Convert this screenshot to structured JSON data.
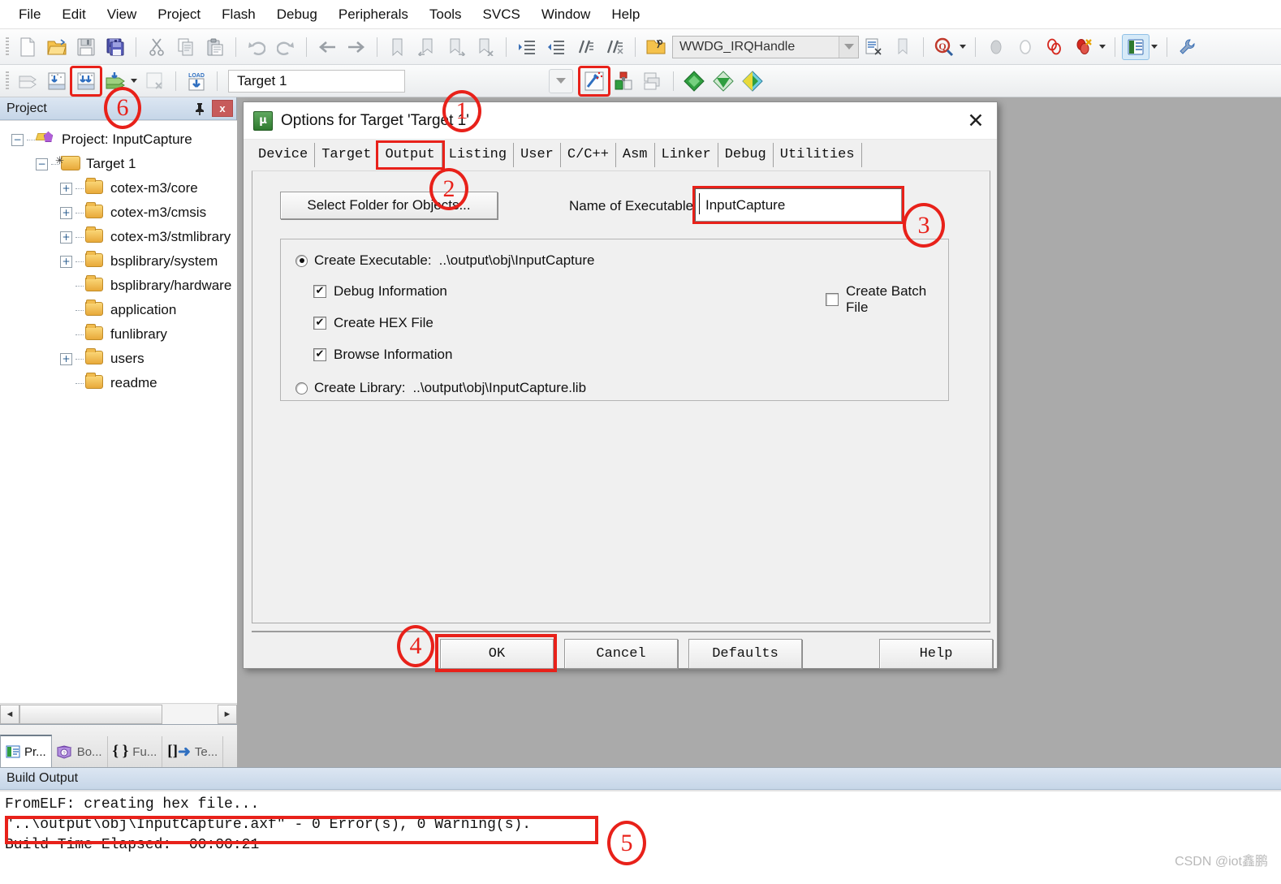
{
  "menubar": {
    "items": [
      {
        "label": "File"
      },
      {
        "label": "Edit"
      },
      {
        "label": "View"
      },
      {
        "label": "Project"
      },
      {
        "label": "Flash"
      },
      {
        "label": "Debug"
      },
      {
        "label": "Peripherals"
      },
      {
        "label": "Tools"
      },
      {
        "label": "SVCS"
      },
      {
        "label": "Window"
      },
      {
        "label": "Help"
      }
    ]
  },
  "toolbar1": {
    "icons": [
      "new-file-icon",
      "open-file-icon",
      "save-icon",
      "save-all-icon",
      "cut-icon",
      "copy-icon",
      "paste-icon",
      "undo-icon",
      "redo-icon",
      "navigate-back-icon",
      "navigate-forward-icon",
      "bookmark-toggle-icon",
      "bookmark-prev-icon",
      "bookmark-next-icon",
      "bookmark-clear-icon",
      "indent-icon",
      "outdent-icon",
      "comment-icon",
      "uncomment-icon",
      "open-file-browse-icon"
    ],
    "function_combo": {
      "value": "WWDG_IRQHandle",
      "dropdown_icon": "chevron-down-icon"
    },
    "after_combo_icons": [
      "file-properties-icon",
      "bookmark-gray-icon",
      "find-in-files-icon",
      "find-dropdown-arrow",
      "breakpoint-gray-icon",
      "breakpoint-hollow-icon",
      "breakpoint-red-icon",
      "breakpoints-kill-icon",
      "breakpoints-dropdown-arrow",
      "window-layout-icon",
      "layout-dropdown-arrow",
      "configure-tools-icon"
    ]
  },
  "toolbar2": {
    "icons": [
      "translate-icon",
      "build-icon",
      "rebuild-all-icon",
      "batch-build-icon",
      "batch-build-dropdown",
      "stop-build-icon",
      "load-download-icon"
    ],
    "target_combo": {
      "value": "Target 1",
      "dropdown_icon": "chevron-down-icon"
    },
    "right_icons": [
      "options-for-target-icon",
      "manage-runtime-env-icon",
      "multi-project-icon",
      "svcs-green-icon",
      "pack-installer-icon",
      "manage-project-items-icon"
    ]
  },
  "project_panel": {
    "title": "Project",
    "pin_icon": "pin-icon",
    "close_icon": "close-icon",
    "tree": [
      {
        "label": "Project: InputCapture",
        "depth": 0,
        "expander": "minus",
        "icon": "project-icon"
      },
      {
        "label": "Target 1",
        "depth": 1,
        "expander": "minus",
        "icon": "target-icon"
      },
      {
        "label": "cotex-m3/core",
        "depth": 2,
        "expander": "plus",
        "icon": "folder-icon"
      },
      {
        "label": "cotex-m3/cmsis",
        "depth": 2,
        "expander": "plus",
        "icon": "folder-icon"
      },
      {
        "label": "cotex-m3/stmlibrary",
        "depth": 2,
        "expander": "plus",
        "icon": "folder-icon"
      },
      {
        "label": "bsplibrary/system",
        "depth": 2,
        "expander": "plus",
        "icon": "folder-icon"
      },
      {
        "label": "bsplibrary/hardware",
        "depth": 2,
        "expander": "none",
        "icon": "folder-icon"
      },
      {
        "label": "application",
        "depth": 2,
        "expander": "none",
        "icon": "folder-icon"
      },
      {
        "label": "funlibrary",
        "depth": 2,
        "expander": "none",
        "icon": "folder-icon"
      },
      {
        "label": "users",
        "depth": 2,
        "expander": "plus",
        "icon": "folder-icon"
      },
      {
        "label": "readme",
        "depth": 2,
        "expander": "none",
        "icon": "folder-icon"
      }
    ],
    "hscroll": {
      "left_arrow": "◄",
      "right_arrow": "►"
    },
    "tabs": [
      {
        "label": "Pr...",
        "icon": "project-window-icon",
        "active": true
      },
      {
        "label": "Bo...",
        "icon": "books-icon",
        "active": false
      },
      {
        "label": "Fu...",
        "icon": "functions-icon",
        "active": false
      },
      {
        "label": "Te...",
        "icon": "templates-icon",
        "active": false
      }
    ]
  },
  "dialog": {
    "icon": "keil-uvision-icon",
    "title": "Options for Target 'Target 1'",
    "close_icon": "close-icon",
    "tabs": [
      {
        "label": "Device",
        "selected": false
      },
      {
        "label": "Target",
        "selected": false
      },
      {
        "label": "Output",
        "selected": true
      },
      {
        "label": "Listing",
        "selected": false
      },
      {
        "label": "User",
        "selected": false
      },
      {
        "label": "C/C++",
        "selected": false
      },
      {
        "label": "Asm",
        "selected": false
      },
      {
        "label": "Linker",
        "selected": false
      },
      {
        "label": "Debug",
        "selected": false
      },
      {
        "label": "Utilities",
        "selected": false
      }
    ],
    "select_folder_button": "Select Folder for Objects...",
    "name_of_executable_label": "Name of Executable:",
    "name_of_executable_value": "InputCapture",
    "create_executable": {
      "label": "Create Executable:",
      "path": "..\\output\\obj\\InputCapture",
      "checked": true
    },
    "checkboxes": [
      {
        "label": "Debug Information",
        "checked": true
      },
      {
        "label": "Create HEX File",
        "checked": true
      },
      {
        "label": "Browse Information",
        "checked": true
      }
    ],
    "create_batch_file": {
      "label": "Create Batch File",
      "checked": false
    },
    "create_library": {
      "label": "Create Library:",
      "path": "..\\output\\obj\\InputCapture.lib",
      "checked": false
    },
    "buttons": [
      {
        "label": "OK",
        "highlighted": true
      },
      {
        "label": "Cancel",
        "highlighted": false
      },
      {
        "label": "Defaults",
        "highlighted": false
      },
      {
        "label": "Help",
        "highlighted": false
      }
    ]
  },
  "build_output": {
    "title": "Build Output",
    "lines": [
      "FromELF: creating hex file...",
      "\"..\\output\\obj\\InputCapture.axf\" - 0 Error(s), 0 Warning(s).",
      "Build Time Elapsed:  00:00:21"
    ]
  },
  "watermark": "CSDN @iot鑫鹏",
  "annotations": [
    {
      "number": "1"
    },
    {
      "number": "2"
    },
    {
      "number": "3"
    },
    {
      "number": "4"
    },
    {
      "number": "5"
    },
    {
      "number": "6"
    }
  ],
  "colors": {
    "annotation_red": "#e8211a",
    "panel_header_blue": "#c6d6e8",
    "editor_background": "#aaaaaa",
    "dialog_face": "#f0f0f0"
  }
}
